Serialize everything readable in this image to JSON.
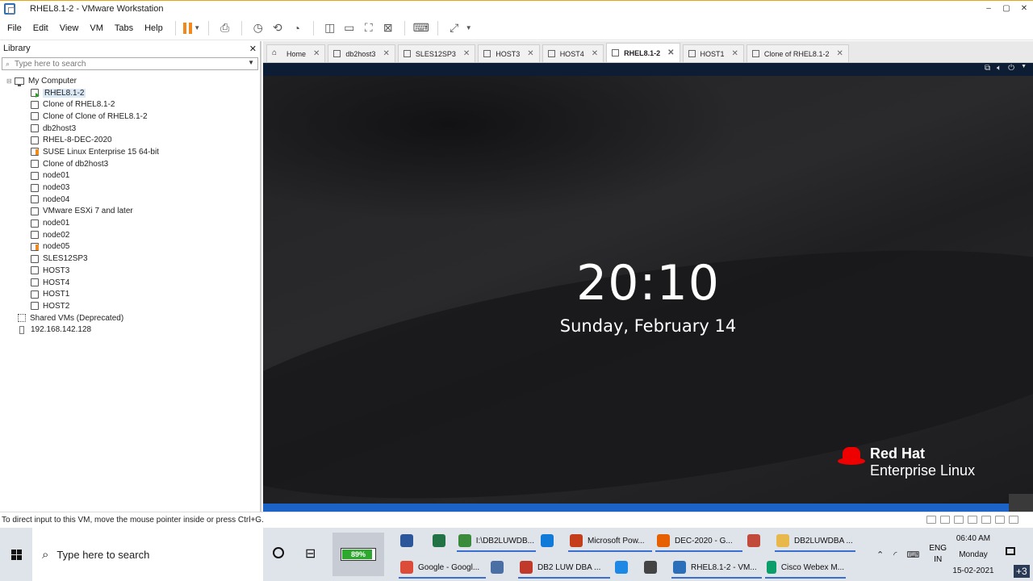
{
  "window": {
    "title": "RHEL8.1-2 - VMware Workstation",
    "controls": {
      "minimize": "–",
      "maximize": "▢",
      "close": "✕"
    }
  },
  "menu": [
    "File",
    "Edit",
    "View",
    "VM",
    "Tabs",
    "Help"
  ],
  "library": {
    "title": "Library",
    "close": "✕",
    "search_placeholder": "Type here to search",
    "root": "My Computer",
    "items": [
      {
        "label": "RHEL8.1-2",
        "state": "running"
      },
      {
        "label": "Clone of RHEL8.1-2",
        "state": "off"
      },
      {
        "label": "Clone of Clone of RHEL8.1-2",
        "state": "off"
      },
      {
        "label": "db2host3",
        "state": "off"
      },
      {
        "label": "RHEL-8-DEC-2020",
        "state": "off"
      },
      {
        "label": "SUSE Linux Enterprise 15 64-bit",
        "state": "paused"
      },
      {
        "label": "Clone of db2host3",
        "state": "off"
      },
      {
        "label": "node01",
        "state": "off"
      },
      {
        "label": "node03",
        "state": "off"
      },
      {
        "label": "node04",
        "state": "off"
      },
      {
        "label": "VMware ESXi 7 and later",
        "state": "off"
      },
      {
        "label": "node01",
        "state": "off"
      },
      {
        "label": "node02",
        "state": "off"
      },
      {
        "label": "node05",
        "state": "paused"
      },
      {
        "label": "SLES12SP3",
        "state": "off"
      },
      {
        "label": "HOST3",
        "state": "off"
      },
      {
        "label": "HOST4",
        "state": "off"
      },
      {
        "label": "HOST1",
        "state": "off"
      },
      {
        "label": "HOST2",
        "state": "off"
      }
    ],
    "shared": "Shared VMs (Deprecated)",
    "server": "192.168.142.128"
  },
  "tabs": [
    {
      "label": "Home",
      "icon": "home-icon",
      "active": false
    },
    {
      "label": "db2host3",
      "active": false
    },
    {
      "label": "SLES12SP3",
      "active": false
    },
    {
      "label": "HOST3",
      "active": false
    },
    {
      "label": "HOST4",
      "active": false
    },
    {
      "label": "RHEL8.1-2",
      "active": true
    },
    {
      "label": "HOST1",
      "active": false
    },
    {
      "label": "Clone of RHEL8.1-2",
      "active": false
    }
  ],
  "lockscreen": {
    "time": "20:10",
    "date": "Sunday, February 14",
    "brand_line1": "Red Hat",
    "brand_line2": "Enterprise Linux"
  },
  "statusbar": {
    "hint": "To direct input to this VM, move the mouse pointer inside or press Ctrl+G."
  },
  "taskbar": {
    "search_placeholder": "Type here to search",
    "battery_percent": "89%",
    "battery_level": 0.89,
    "row1": [
      {
        "label": "",
        "icon": "word-icon",
        "color": "#2b579a"
      },
      {
        "label": "",
        "icon": "excel-icon",
        "color": "#217346"
      },
      {
        "label": "I:\\DB2LUWDB...",
        "icon": "folder-app-icon",
        "color": "#3c8b3c"
      },
      {
        "label": "",
        "icon": "edge-icon",
        "color": "#0f7ad8"
      },
      {
        "label": "Microsoft Pow...",
        "icon": "powerpoint-icon",
        "color": "#c43e1c"
      },
      {
        "label": "DEC-2020 - G...",
        "icon": "firefox-icon",
        "color": "#e66000"
      },
      {
        "label": "",
        "icon": "paint-icon",
        "color": "#c24a3b"
      },
      {
        "label": "DB2LUWDBA ...",
        "icon": "file-explorer-icon",
        "color": "#e8b84a"
      }
    ],
    "row2": [
      {
        "label": "Google - Googl...",
        "icon": "chrome-icon",
        "color": "#dd4b39"
      },
      {
        "label": "",
        "icon": "network-app-icon",
        "color": "#4a6fa5"
      },
      {
        "label": "DB2 LUW DBA ...",
        "icon": "pdf-icon",
        "color": "#c0392b"
      },
      {
        "label": "",
        "icon": "ie-icon",
        "color": "#1e88e5"
      },
      {
        "label": "",
        "icon": "outlook-icon",
        "color": "#444"
      },
      {
        "label": "RHEL8.1-2 - VM...",
        "icon": "vmware-icon",
        "color": "#2b6fbb"
      },
      {
        "label": "Cisco Webex M...",
        "icon": "webex-icon",
        "color": "#0a9e6b"
      }
    ],
    "lang_line1": "ENG",
    "lang_line2": "IN",
    "clock_time": "06:40 AM",
    "clock_day": "Monday",
    "clock_date": "15-02-2021",
    "overflow": "+3"
  }
}
